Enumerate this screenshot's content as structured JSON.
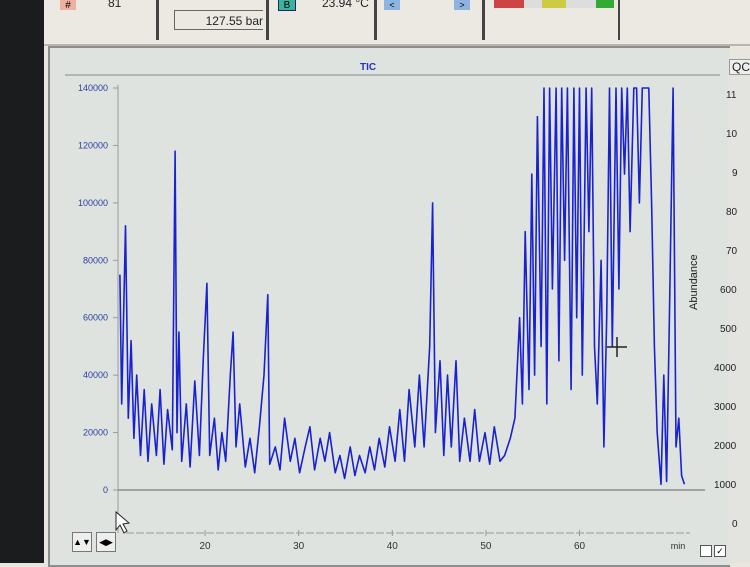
{
  "toolbar": {
    "hash_label": "#",
    "count_value": "81",
    "pressure": "127.55 bar",
    "channel_badge": "B",
    "temperature": "23.94 °C",
    "prev_label": "<",
    "next_label": ">"
  },
  "right_panel": {
    "tab_label": "QC",
    "axis_label": "Abundance",
    "ticks": [
      "11",
      "10",
      "9",
      "80",
      "70",
      "600",
      "500",
      "4000",
      "3000",
      "2000",
      "1000",
      "0"
    ]
  },
  "controls": {
    "vertical_zoom": "▲▼",
    "horizontal_zoom": "◀▶",
    "checkbox_2": "✓"
  },
  "colors": {
    "trace": "#1a22d0",
    "axis_text": "#2a3fa0"
  },
  "chart_data": {
    "type": "line",
    "title": "TIC",
    "xlabel": "min",
    "ylabel": "",
    "xlim": [
      10.7,
      71.8
    ],
    "ylim": [
      0,
      140000
    ],
    "xticks": [
      20,
      30,
      40,
      50,
      60
    ],
    "yticks": [
      0,
      20000,
      40000,
      60000,
      80000,
      100000,
      120000,
      140000
    ],
    "grid": false,
    "series": [
      {
        "name": "TIC",
        "x": [
          10.9,
          11.1,
          11.5,
          11.8,
          12.1,
          12.4,
          12.7,
          13.1,
          13.5,
          13.9,
          14.3,
          14.8,
          15.2,
          15.6,
          16.0,
          16.5,
          16.8,
          17.0,
          17.2,
          17.5,
          18.0,
          18.4,
          18.9,
          19.4,
          19.8,
          20.2,
          20.5,
          21.0,
          21.4,
          21.8,
          22.2,
          22.7,
          23.0,
          23.3,
          23.7,
          24.3,
          24.8,
          25.3,
          25.8,
          26.3,
          26.7,
          26.9,
          27.5,
          28.0,
          28.5,
          29.1,
          29.6,
          30.1,
          30.7,
          31.2,
          31.7,
          32.3,
          32.8,
          33.3,
          33.9,
          34.4,
          34.9,
          35.5,
          36.0,
          36.5,
          37.1,
          37.6,
          38.1,
          38.6,
          39.2,
          39.7,
          40.3,
          40.8,
          41.3,
          41.8,
          42.4,
          42.9,
          43.4,
          44.0,
          44.3,
          44.6,
          45.1,
          45.5,
          45.9,
          46.3,
          46.8,
          47.2,
          47.7,
          48.3,
          48.8,
          49.3,
          49.9,
          50.4,
          50.9,
          51.5,
          52.0,
          52.6,
          53.1,
          53.6,
          53.9,
          54.2,
          54.6,
          54.9,
          55.2,
          55.5,
          55.9,
          56.2,
          56.5,
          56.8,
          57.1,
          57.5,
          57.8,
          58.1,
          58.4,
          58.7,
          59.1,
          59.4,
          59.7,
          60.0,
          60.3,
          60.7,
          61.0,
          61.3,
          61.6,
          61.9,
          62.3,
          62.6,
          62.9,
          63.2,
          63.5,
          63.9,
          64.2,
          64.5,
          64.8,
          65.1,
          65.4,
          65.8,
          66.1,
          66.4,
          66.7,
          67.0,
          67.4,
          67.7,
          68.0,
          68.3,
          68.7,
          69.0,
          69.3,
          69.6,
          70.0,
          70.3,
          70.6,
          70.9,
          71.2
        ],
        "y": [
          75000,
          30000,
          92000,
          25000,
          52000,
          18000,
          40000,
          12000,
          35000,
          10000,
          30000,
          12000,
          35000,
          9000,
          28000,
          14000,
          118000,
          20000,
          55000,
          10000,
          30000,
          8000,
          38000,
          12000,
          45000,
          72000,
          12000,
          25000,
          7000,
          20000,
          10000,
          40000,
          55000,
          15000,
          30000,
          8000,
          18000,
          6000,
          22000,
          40000,
          68000,
          9000,
          15000,
          7000,
          25000,
          10000,
          18000,
          6000,
          15000,
          22000,
          7000,
          18000,
          10000,
          20000,
          6000,
          12000,
          4000,
          15000,
          5000,
          12000,
          6000,
          15000,
          7000,
          18000,
          8000,
          22000,
          10000,
          28000,
          10000,
          35000,
          15000,
          40000,
          15000,
          50000,
          100000,
          20000,
          45000,
          12000,
          40000,
          15000,
          45000,
          10000,
          25000,
          10000,
          28000,
          10000,
          20000,
          9000,
          22000,
          10000,
          12000,
          18000,
          25000,
          60000,
          30000,
          90000,
          35000,
          110000,
          40000,
          130000,
          50000,
          140000,
          30000,
          140000,
          70000,
          140000,
          45000,
          140000,
          80000,
          140000,
          35000,
          140000,
          60000,
          140000,
          40000,
          140000,
          90000,
          140000,
          50000,
          30000,
          80000,
          15000,
          60000,
          140000,
          50000,
          140000,
          70000,
          140000,
          110000,
          140000,
          90000,
          140000,
          140000,
          100000,
          140000,
          140000,
          140000,
          100000,
          50000,
          20000,
          2000,
          40000,
          3000,
          60000,
          140000,
          15000,
          25000,
          5000,
          2000
        ]
      }
    ]
  }
}
